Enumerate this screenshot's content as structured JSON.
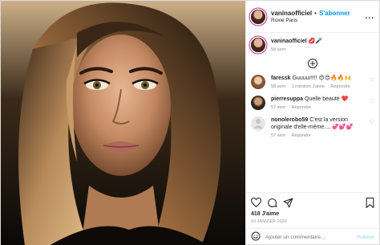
{
  "header": {
    "username": "vaninaofficiel",
    "separator": "•",
    "follow_label": "S'abonner",
    "location": "Roxie Paris",
    "more_label": "..."
  },
  "caption": {
    "username": "vaninaofficiel",
    "text": "💋🎤",
    "time": "58 sem"
  },
  "comments": [
    {
      "username": "faressk",
      "text": "Guuuur!!!! 😍😍🔥🔥🙌",
      "time": "58 sem",
      "likes": "1 mention J'aime",
      "reply": "Répondre"
    },
    {
      "username": "pierresuppa",
      "text": "Quelle beauté ❤️",
      "time": "57 sem",
      "likes": "",
      "reply": "Répondre"
    },
    {
      "username": "nonolerobo59",
      "text": "C'est la version originale d'elle-même.....💞💕💕",
      "time": "57 sem",
      "likes": "",
      "reply": "Répondre"
    }
  ],
  "actions": {
    "likes": "418 J'aime",
    "date": "10 JANVIER 2020"
  },
  "add_comment": {
    "placeholder": "Ajouter un commentaire...",
    "publish_label": "Publier"
  },
  "colors": {
    "follow_blue": "#0095f6",
    "heart_red": "#ed4956"
  }
}
